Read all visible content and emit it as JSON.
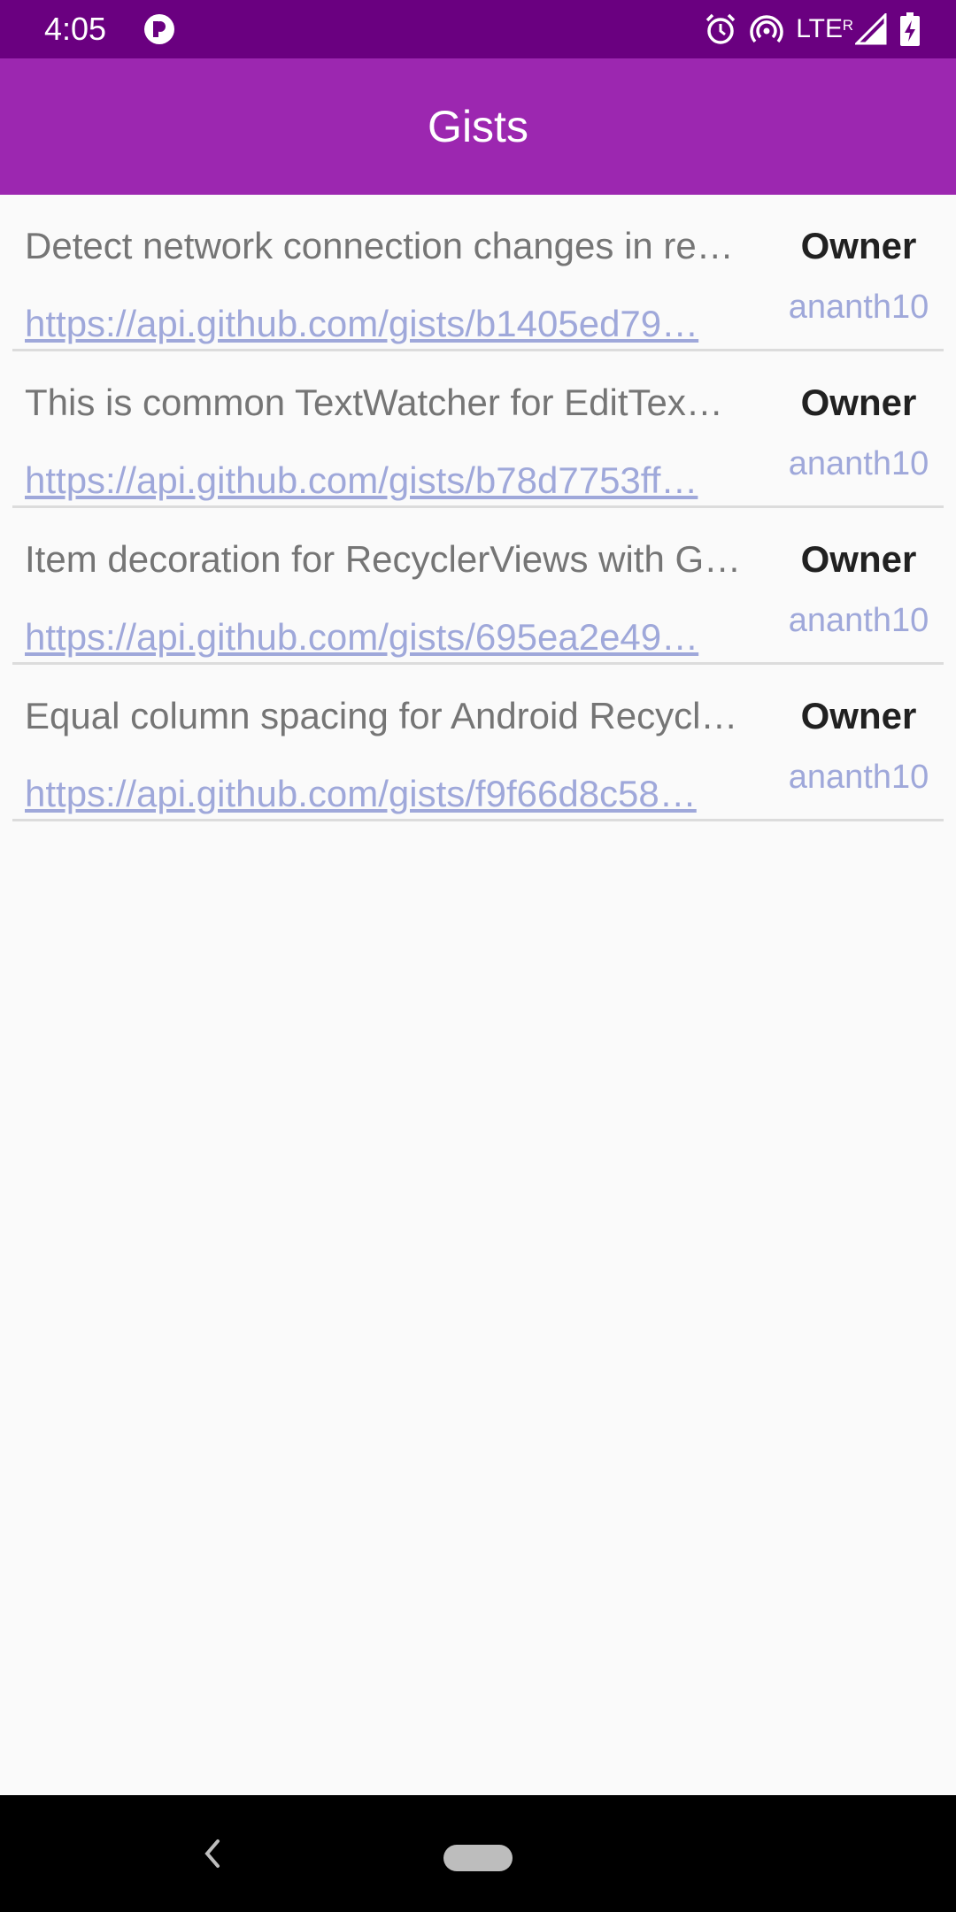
{
  "status_bar": {
    "time": "4:05",
    "network": "LTE",
    "roaming": "R",
    "icons": [
      "alarm-icon",
      "hotspot-icon",
      "signal-icon",
      "battery-charging-icon"
    ]
  },
  "app_bar": {
    "title": "Gists"
  },
  "gists": [
    {
      "description": "Detect network connection changes in re…",
      "url": "https://api.github.com/gists/b1405ed79…",
      "owner_label": "Owner",
      "owner": "ananth10"
    },
    {
      "description": "This is common TextWatcher for EditTex…",
      "url": "https://api.github.com/gists/b78d7753ff…",
      "owner_label": "Owner",
      "owner": "ananth10"
    },
    {
      "description": "Item decoration for RecyclerViews with G…",
      "url": "https://api.github.com/gists/695ea2e49…",
      "owner_label": "Owner",
      "owner": "ananth10"
    },
    {
      "description": "Equal column spacing for Android Recycl…",
      "url": "https://api.github.com/gists/f9f66d8c58…",
      "owner_label": "Owner",
      "owner": "ananth10"
    }
  ],
  "nav_bar": {
    "icons": [
      "back-icon",
      "home-pill-icon"
    ]
  },
  "colors": {
    "status_bar": "#6a0080",
    "app_bar": "#9c27b0",
    "link": "#9fa8da",
    "description": "#757575",
    "owner_label": "#212121"
  }
}
